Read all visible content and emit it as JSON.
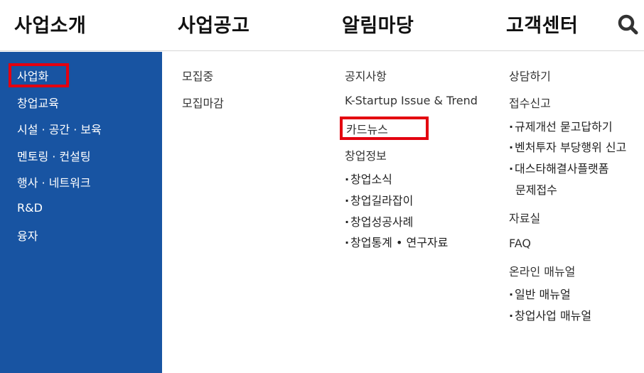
{
  "topnav": {
    "menus": [
      "사업소개",
      "사업공고",
      "알림마당",
      "고객센터"
    ],
    "search_icon": "search-icon"
  },
  "sidebar": {
    "items": [
      "사업화",
      "창업교육",
      "시설 · 공간 · 보육",
      "멘토링 · 컨설팅",
      "행사 · 네트워크",
      "R&D",
      "융자"
    ]
  },
  "announce": {
    "items": [
      "모집중",
      "모집마감"
    ]
  },
  "notice": {
    "items": [
      "공지사항",
      "K-Startup Issue & Trend",
      "카드뉴스",
      "창업정보"
    ],
    "sub_items": [
      "창업소식",
      "창업길라잡이",
      "창업성공사례",
      "창업통계 • 연구자료"
    ]
  },
  "support": {
    "consult": "상담하기",
    "report": "접수신고",
    "report_subs": [
      "규제개선 묻고답하기",
      "벤처투자 부당행위 신고",
      "대스타해결사플랫폼"
    ],
    "report_sub_cont": "문제접수",
    "library": "자료실",
    "faq": "FAQ",
    "manual": "온라인 매뉴얼",
    "manual_subs": [
      "일반 매뉴얼",
      "창업사업 매뉴얼"
    ]
  },
  "colors": {
    "sidebar_bg": "#1854a2",
    "highlight": "#e3000f"
  }
}
